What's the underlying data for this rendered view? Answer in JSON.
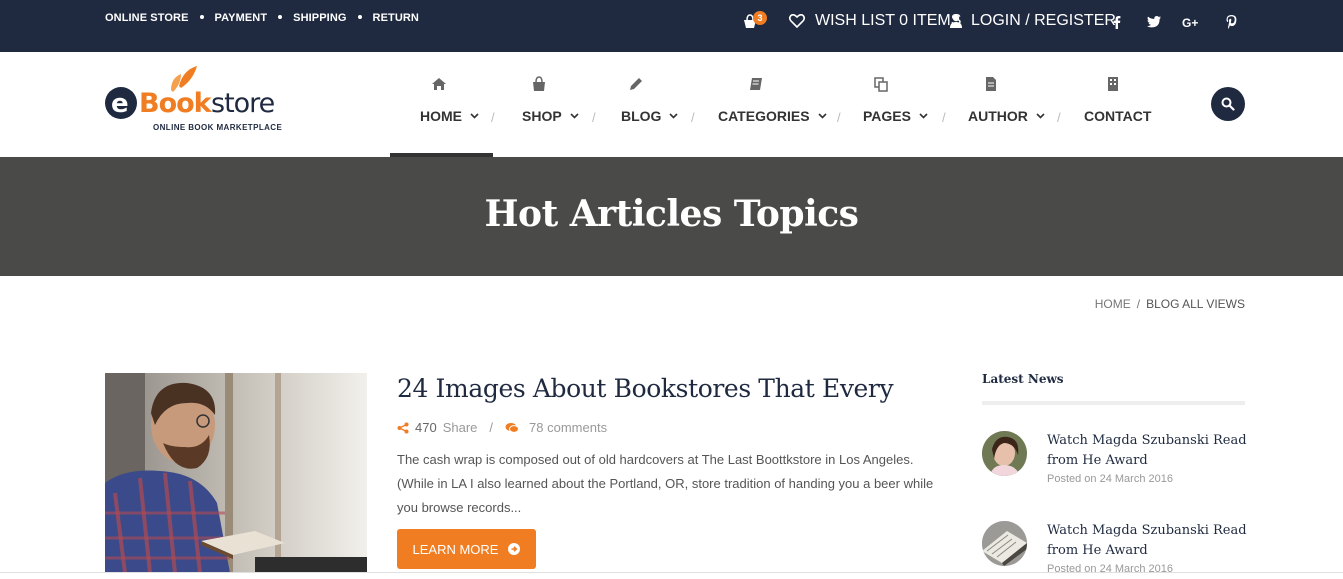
{
  "topbar": {
    "links": [
      "ONLINE STORE",
      "PAYMENT",
      "SHIPPING",
      "RETURN"
    ],
    "cart_count": "3",
    "wishlist": "WISH LIST 0 ITEMS",
    "login": "LOGIN / REGISTER",
    "social": [
      "facebook-icon",
      "twitter-icon",
      "google-plus-icon",
      "pinterest-icon"
    ]
  },
  "logo": {
    "brand_e": "e",
    "brand_book": "Book",
    "brand_store": "store",
    "tagline": "ONLINE BOOK MARKETPLACE"
  },
  "nav": [
    {
      "label": "HOME",
      "icon": "home-icon",
      "dropdown": true,
      "active": true
    },
    {
      "label": "SHOP",
      "icon": "shopping-bag-icon",
      "dropdown": true
    },
    {
      "label": "BLOG",
      "icon": "pencil-icon",
      "dropdown": true
    },
    {
      "label": "CATEGORIES",
      "icon": "book-icon",
      "dropdown": true
    },
    {
      "label": "PAGES",
      "icon": "copy-icon",
      "dropdown": true
    },
    {
      "label": "AUTHOR",
      "icon": "file-icon",
      "dropdown": true
    },
    {
      "label": "CONTACT",
      "icon": "building-icon",
      "dropdown": false
    }
  ],
  "hero": {
    "title": "Hot Articles Topics"
  },
  "breadcrumb": {
    "home": "HOME",
    "sep": "/",
    "current": "BLOG ALL VIEWS"
  },
  "article": {
    "title": "24 Images About Bookstores That Every",
    "share_count": "470",
    "share_label": "Share",
    "meta_sep": "/",
    "comments": "78 comments",
    "excerpt": "The cash wrap is composed out of old hardcovers at The Last Boottkstore in Los Angeles. (While in LA I also learned about the Portland, OR, store tradition of handing you a beer while you browse records...",
    "button": "LEARN MORE"
  },
  "sidebar": {
    "title": "Latest News",
    "items": [
      {
        "title": "Watch Magda Szubanski Read from He Award",
        "date": "Posted on 24 March 2016"
      },
      {
        "title": "Watch Magda Szubanski Read from He Award",
        "date": "Posted on 24 March 2016"
      }
    ]
  },
  "colors": {
    "navy": "#1f2a40",
    "accent": "#f07d22",
    "hero_bg": "#4a4a49"
  }
}
